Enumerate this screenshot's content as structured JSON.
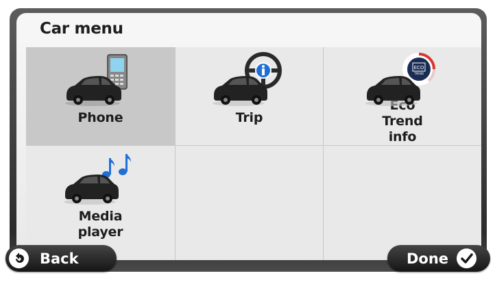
{
  "screen": {
    "title": "Car menu"
  },
  "menu": {
    "items": [
      {
        "label": "Phone",
        "icon": "car-phone-icon",
        "selected": true
      },
      {
        "label": "Trip",
        "icon": "car-steering-info-icon",
        "selected": false
      },
      {
        "label": "Eco Trend info",
        "icon": "car-eco-trend-icon",
        "selected": false
      },
      {
        "label": "Media player",
        "icon": "car-music-notes-icon",
        "selected": false
      }
    ]
  },
  "buttons": {
    "back_label": "Back",
    "done_label": "Done"
  },
  "colors": {
    "frame": "#2b2b2b",
    "panel": "#ececec",
    "selected_cell": "#c8c8c8",
    "info_blue": "#1f6fd6",
    "eco_red": "#d9382e"
  }
}
